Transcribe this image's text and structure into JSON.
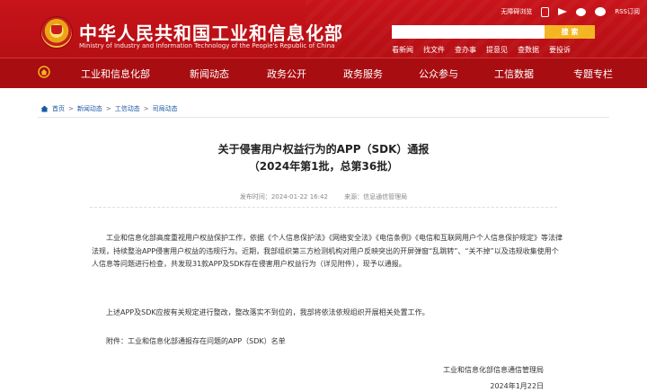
{
  "header": {
    "site_name": "中华人民共和国工业和信息化部",
    "site_name_en": "Ministry of Industry and Information Technology of the People's Republic of China",
    "top_links": {
      "accessibility": "无障碍浏览",
      "rss": "RSS订阅"
    },
    "search": {
      "placeholder": "",
      "button": "搜 索"
    },
    "quick_links": [
      "看新闻",
      "找文件",
      "查办事",
      "提意见",
      "查数据",
      "要投诉"
    ]
  },
  "nav": {
    "items": [
      "工业和信息化部",
      "新闻动态",
      "政务公开",
      "政务服务",
      "公众参与",
      "工信数据",
      "专题专栏"
    ]
  },
  "breadcrumb": [
    "首页",
    "新闻动态",
    "工信动态",
    "司局动态"
  ],
  "article": {
    "title_line1": "关于侵害用户权益行为的APP（SDK）通报",
    "title_line2": "（2024年第1批，总第36批）",
    "published": "发布时间：2024-01-22 16:42",
    "source": "来源：信息通信管理局",
    "paragraph1": "工业和信息化部高度重视用户权益保护工作，依据《个人信息保护法》《网络安全法》《电信条例》《电信和互联网用户个人信息保护规定》等法律法规，持续整治APP侵害用户权益的违规行为。近期，我部组织第三方检测机构对用户反映突出的开屏弹窗“乱跳转”、“关不掉”以及违规收集使用个人信息等问题进行检查，共发现31款APP及SDK存在侵害用户权益行为（详见附件），现予以通报。",
    "paragraph2": "上述APP及SDK应按有关规定进行整改，整改落实不到位的，我部将依法依规组织开展相关处置工作。",
    "paragraph3": "附件：工业和信息化部通报存在问题的APP（SDK）名单",
    "signature": "工业和信息化部信息通信管理局",
    "date": "2024年1月22日"
  },
  "colors": {
    "header_red": "#c8141a",
    "nav_red": "#a80d11",
    "search_button": "#f3b520",
    "breadcrumb_link": "#1a5aa6"
  },
  "icons": [
    "emblem",
    "phone-icon",
    "send-icon",
    "weibo-icon",
    "wechat-icon",
    "home-icon"
  ]
}
